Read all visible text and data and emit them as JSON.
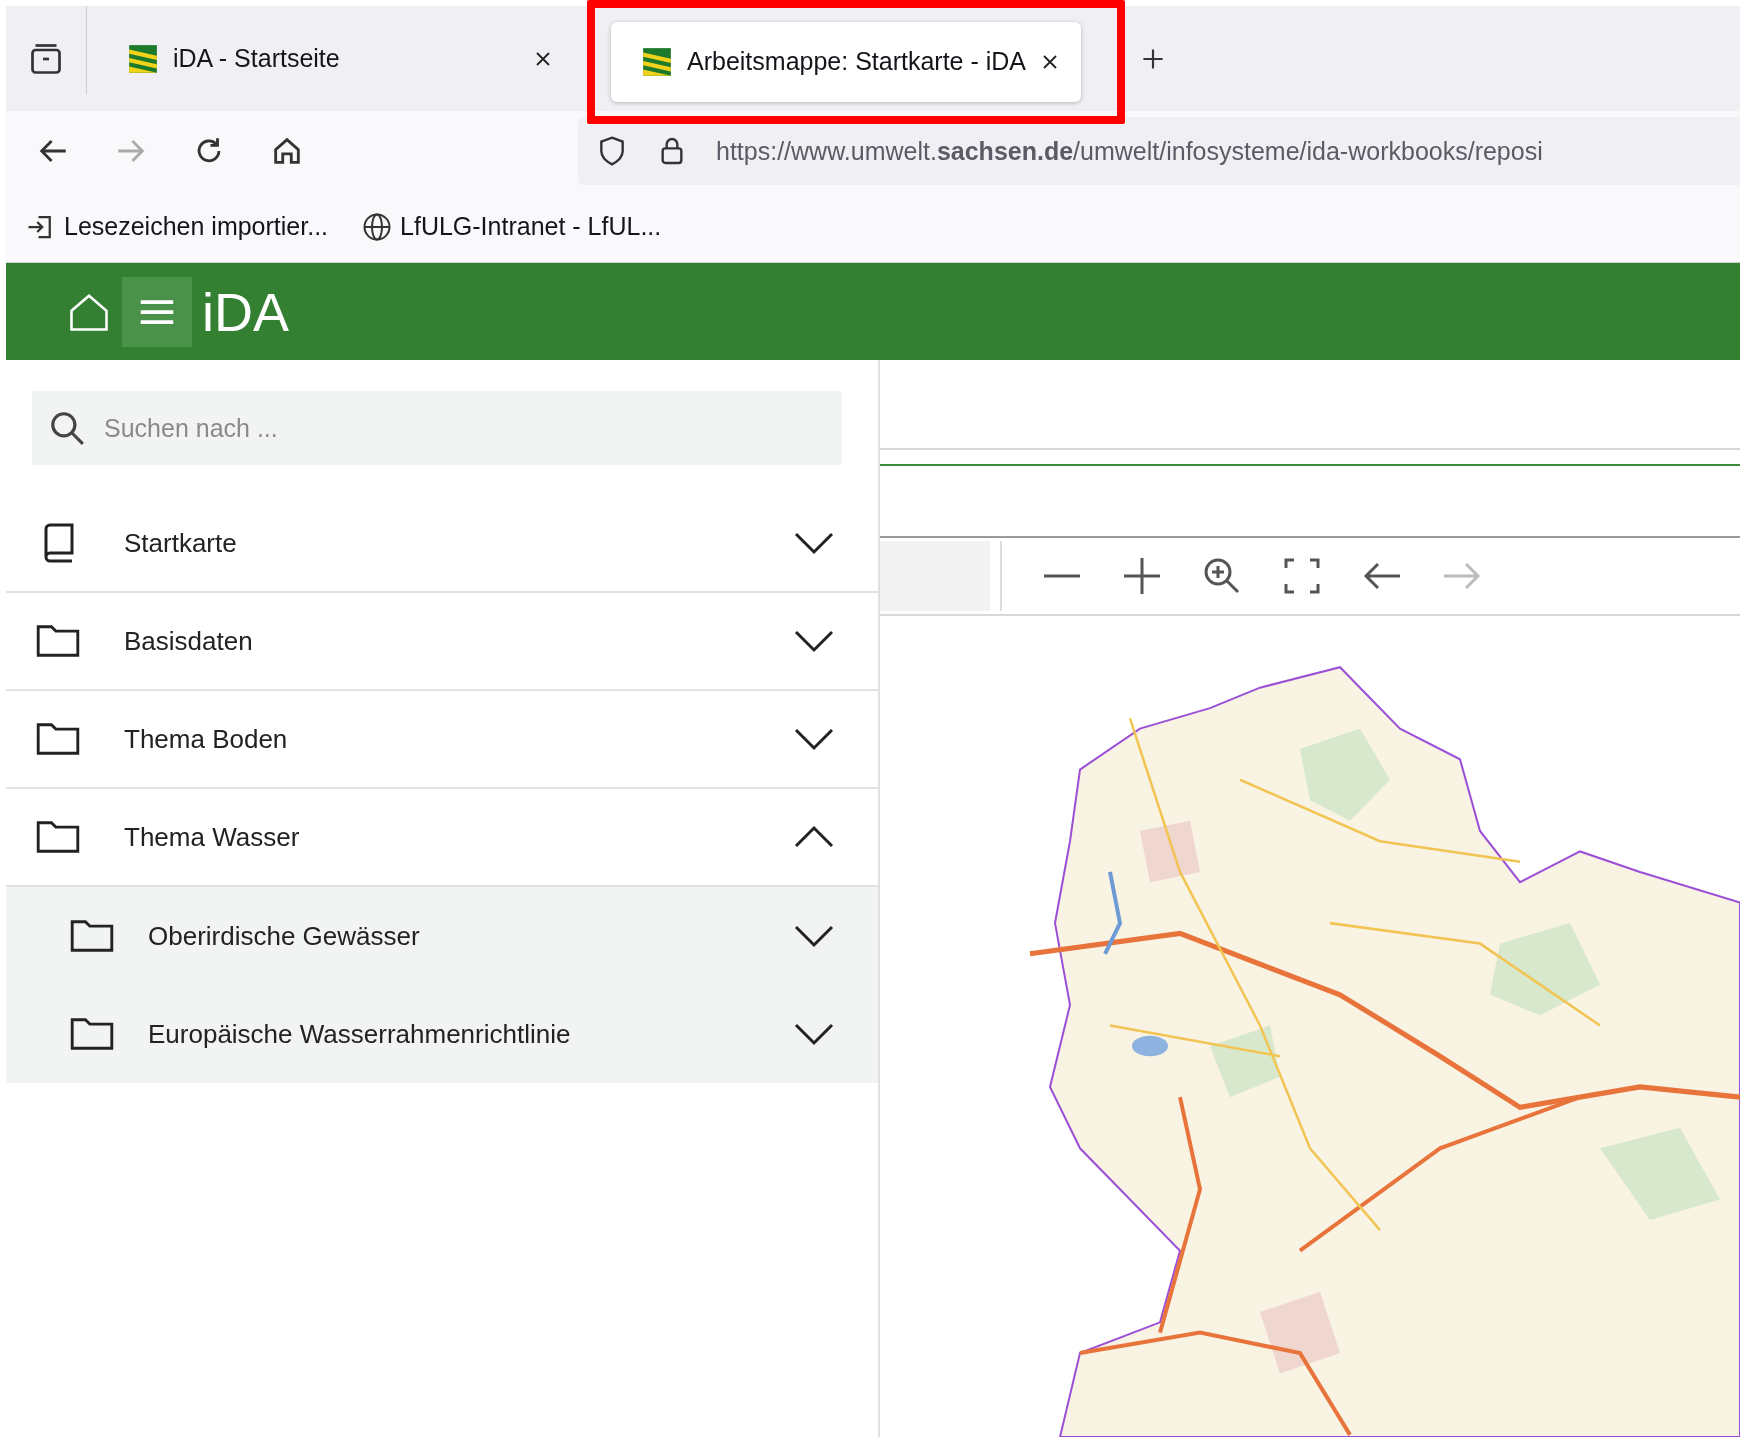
{
  "browser": {
    "tabs": [
      {
        "title": "iDA - Startseite",
        "selected": false,
        "highlighted": false
      },
      {
        "title": "Arbeitsmappe: Startkarte - iDA",
        "selected": true,
        "highlighted": true
      }
    ],
    "nav": [
      {
        "kind": "back",
        "disabled": false
      },
      {
        "kind": "forward",
        "disabled": true
      },
      {
        "kind": "reload",
        "disabled": false
      },
      {
        "kind": "home",
        "disabled": false
      }
    ],
    "url": "https://www.umwelt.**sachsen.de**/umwelt/infosysteme/ida-workbooks/reposi",
    "bookmarks": [
      {
        "kind": "import",
        "label": "Lesezeichen importier..."
      },
      {
        "kind": "globe",
        "label": "LfULG-Intranet - LfUL..."
      }
    ]
  },
  "app": {
    "title": "iDA",
    "search": {
      "placeholder": "Suchen nach ..."
    },
    "tree": [
      {
        "kind": "book",
        "label": "Startkarte",
        "expanded": false
      },
      {
        "kind": "folder",
        "label": "Basisdaten",
        "expanded": false
      },
      {
        "kind": "folder",
        "label": "Thema Boden",
        "expanded": false
      },
      {
        "kind": "folder",
        "label": "Thema Wasser",
        "expanded": true,
        "children": [
          {
            "kind": "folder",
            "label": "Oberirdische Gewässer",
            "expanded": false
          },
          {
            "kind": "folder",
            "label": "Europäische Wasserrahmenrichtlinie",
            "expanded": false
          }
        ]
      }
    ],
    "map_tools": [
      {
        "kind": "zoom-out",
        "disabled": false
      },
      {
        "kind": "zoom-in",
        "disabled": false
      },
      {
        "kind": "zoom-box",
        "disabled": false
      },
      {
        "kind": "full-extent",
        "disabled": false
      },
      {
        "kind": "back",
        "disabled": false
      },
      {
        "kind": "forward",
        "disabled": true
      }
    ]
  }
}
